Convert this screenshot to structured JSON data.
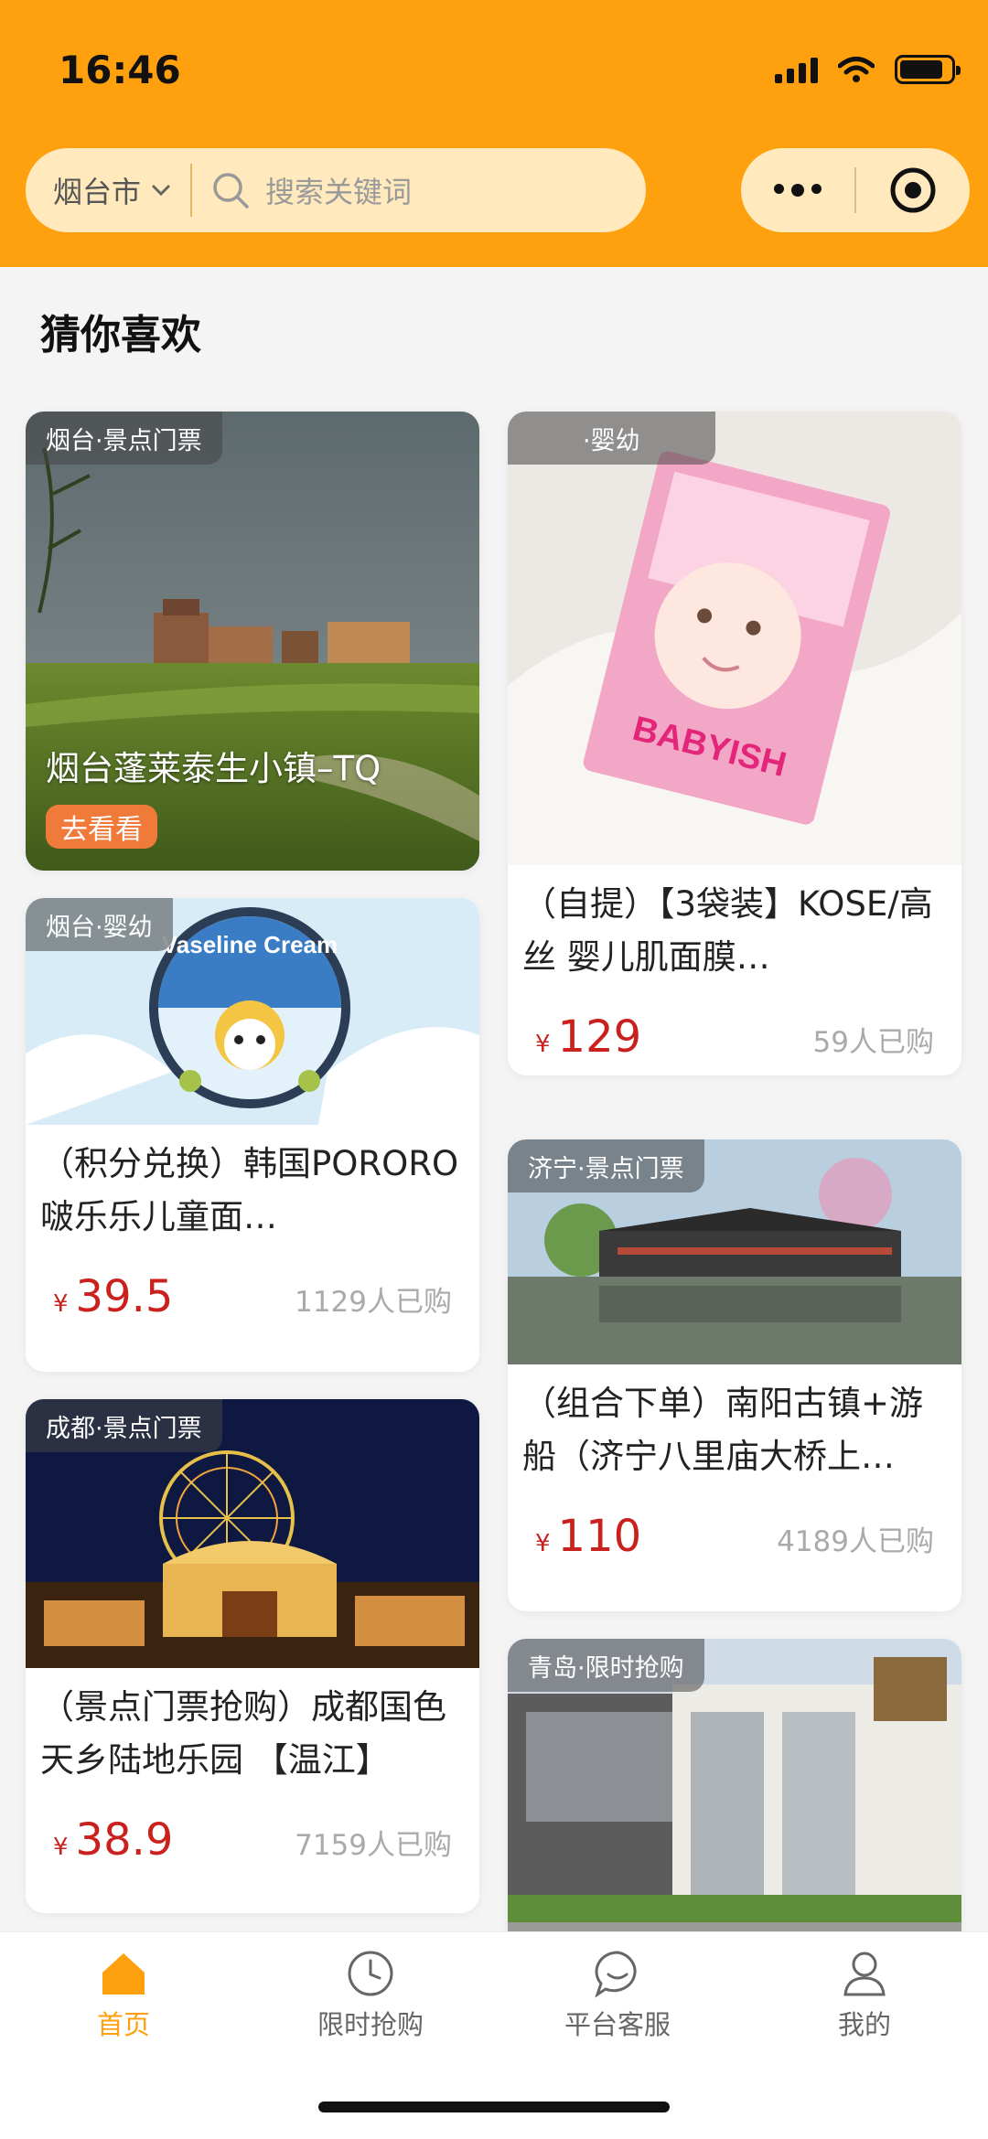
{
  "status": {
    "time": "16:46"
  },
  "header": {
    "city": "烟台市",
    "search_placeholder": "搜索关键词"
  },
  "section": {
    "title": "猜你喜欢"
  },
  "banner": {
    "tag": "烟台·景点门票",
    "title": "烟台蓬莱泰生小镇–TQ",
    "button": "去看看"
  },
  "cards": [
    {
      "tag": "·婴幼",
      "title": "（自提）【3袋装】KOSE/高丝 婴儿肌面膜…",
      "currency": "¥",
      "price": "129",
      "sold": "59人已购",
      "image_text": "BABYISH"
    },
    {
      "tag": "烟台·婴幼",
      "title": "（积分兑换）韩国PORORO啵乐乐儿童面…",
      "currency": "¥",
      "price": "39.5",
      "sold": "1129人已购",
      "image_text": "Vaseline Cream"
    },
    {
      "tag": "济宁·景点门票",
      "title": "（组合下单）南阳古镇+游船（济宁八里庙大桥上…",
      "currency": "¥",
      "price": "110",
      "sold": "4189人已购"
    },
    {
      "tag": "成都·景点门票",
      "title": "（景点门票抢购）成都国色天乡陆地乐园 【温江】",
      "currency": "¥",
      "price": "38.9",
      "sold": "7159人已购"
    },
    {
      "tag": "青岛·限时抢购",
      "title": ""
    }
  ],
  "tabs": [
    {
      "label": "首页",
      "icon": "home-icon",
      "active": true
    },
    {
      "label": "限时抢购",
      "icon": "clock-icon",
      "active": false
    },
    {
      "label": "平台客服",
      "icon": "chat-icon",
      "active": false
    },
    {
      "label": "我的",
      "icon": "user-icon",
      "active": false
    }
  ],
  "colors": {
    "brand": "#ffa10e",
    "price": "#c8211e",
    "button": "#f07a3a"
  }
}
